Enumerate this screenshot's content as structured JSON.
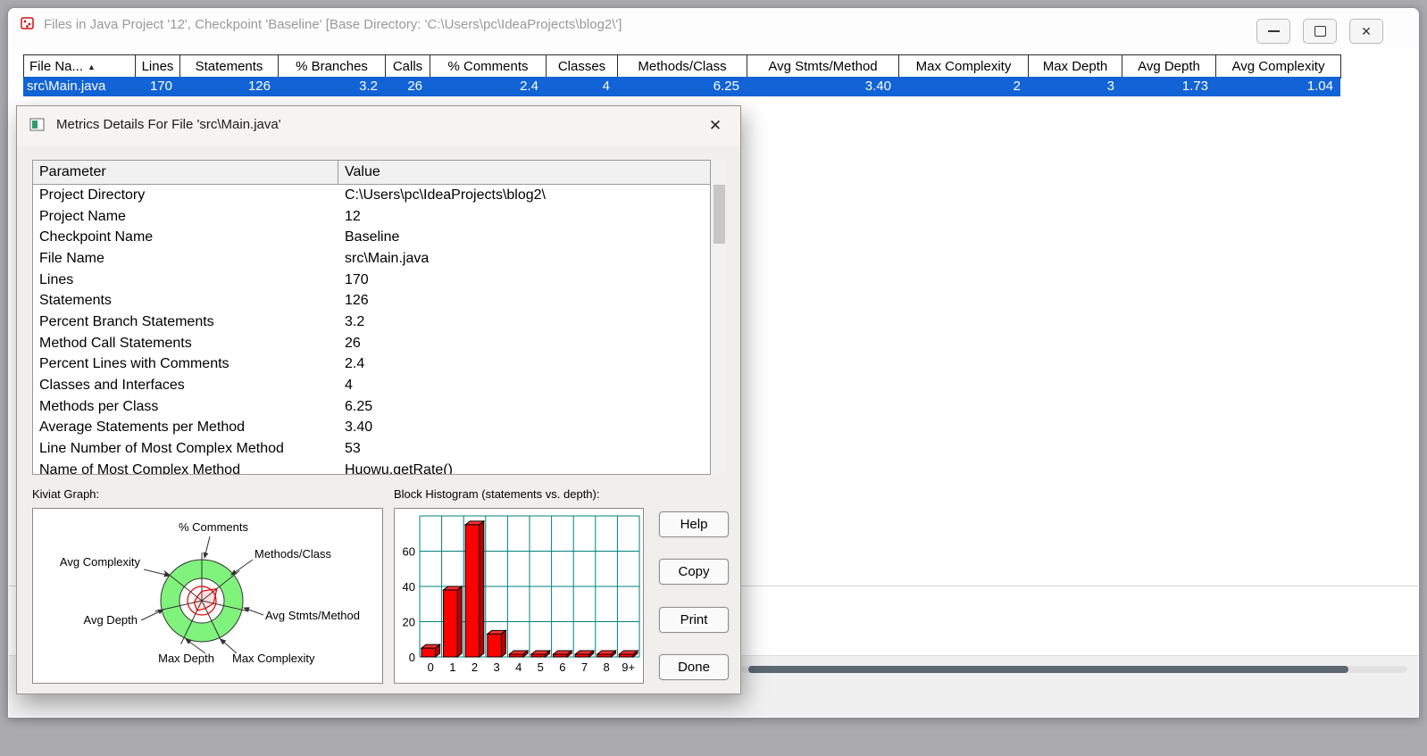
{
  "icons": {
    "close": "✕",
    "sort_ascending": "▲"
  },
  "colors": {
    "selection_blue": "#1263d6",
    "bar_red": "#ff0000",
    "grid_teal": "#008080",
    "ring_green": "#80f37c"
  },
  "main_window": {
    "title": "Files in Java Project '12', Checkpoint 'Baseline'  [Base Directory: 'C:\\Users\\pc\\IdeaProjects\\blog2\\']",
    "columns": [
      "File Na...",
      "Lines",
      "Statements",
      "% Branches",
      "Calls",
      "% Comments",
      "Classes",
      "Methods/Class",
      "Avg Stmts/Method",
      "Max Complexity",
      "Max Depth",
      "Avg Depth",
      "Avg Complexity"
    ],
    "row": [
      "src\\Main.java",
      "170",
      "126",
      "3.2",
      "26",
      "2.4",
      "4",
      "6.25",
      "3.40",
      "2",
      "3",
      "1.73",
      "1.04"
    ]
  },
  "dialog": {
    "title": "Metrics Details For File 'src\\Main.java'",
    "table": {
      "headers": [
        "Parameter",
        "Value"
      ],
      "rows": [
        {
          "param": "Project Directory",
          "value": "C:\\Users\\pc\\IdeaProjects\\blog2\\"
        },
        {
          "param": "Project Name",
          "value": "12"
        },
        {
          "param": "Checkpoint Name",
          "value": "Baseline"
        },
        {
          "param": "File Name",
          "value": "src\\Main.java"
        },
        {
          "param": "Lines",
          "value": "170"
        },
        {
          "param": "Statements",
          "value": "126"
        },
        {
          "param": "Percent Branch Statements",
          "value": "3.2"
        },
        {
          "param": "Method Call Statements",
          "value": "26"
        },
        {
          "param": "Percent Lines with Comments",
          "value": "2.4"
        },
        {
          "param": "Classes and Interfaces",
          "value": "4"
        },
        {
          "param": "Methods per Class",
          "value": "6.25"
        },
        {
          "param": "Average Statements per Method",
          "value": "3.40"
        },
        {
          "param": "Line Number of Most Complex Method",
          "value": "53"
        },
        {
          "param": "Name of Most Complex Method",
          "value": "Huowu.getRate()"
        }
      ]
    },
    "kiviat_label": "Kiviat Graph:",
    "histogram_label": "Block Histogram (statements vs. depth):",
    "buttons": [
      "Help",
      "Copy",
      "Print",
      "Done"
    ]
  },
  "chart_data": [
    {
      "type": "radar",
      "title": "Kiviat Graph",
      "metrics": [
        "% Comments",
        "Methods/Class",
        "Avg Stmts/Method",
        "Max Complexity",
        "Max Depth",
        "Avg Depth",
        "Avg Complexity"
      ],
      "values": [
        2.4,
        6.25,
        3.4,
        2,
        3,
        1.73,
        1.04
      ],
      "ring_color": "#80f37c"
    },
    {
      "type": "bar",
      "title": "Block Histogram (statements vs. depth)",
      "categories": [
        "0",
        "1",
        "2",
        "3",
        "4",
        "5",
        "6",
        "7",
        "8",
        "9+"
      ],
      "values": [
        5,
        38,
        75,
        13,
        0,
        0,
        0,
        0,
        0,
        0
      ],
      "xlabel": "depth",
      "ylabel": "statements",
      "ylim": [
        0,
        80
      ],
      "yticks": [
        0,
        20,
        40,
        60
      ],
      "bar_color": "#ff0000",
      "grid_color": "#008080"
    }
  ]
}
